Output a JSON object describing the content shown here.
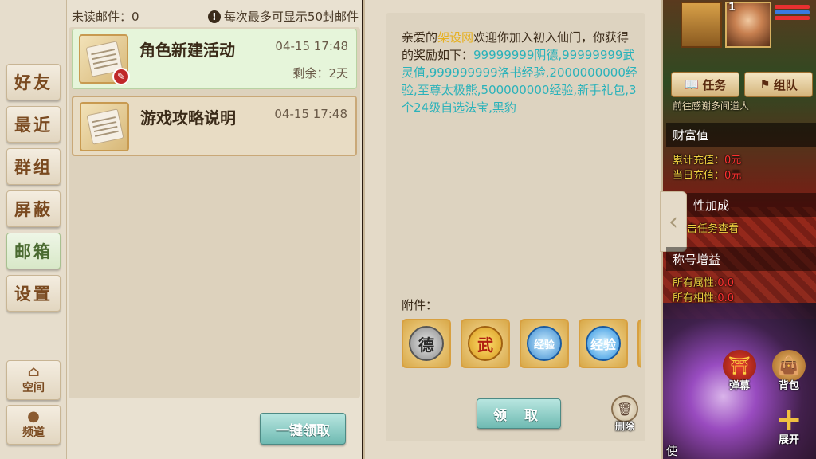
{
  "nav": {
    "items": [
      {
        "label": "好友"
      },
      {
        "label": "最近"
      },
      {
        "label": "群组"
      },
      {
        "label": "屏蔽"
      },
      {
        "label": "邮箱"
      },
      {
        "label": "设置"
      }
    ],
    "space_label": "空间",
    "channel_label": "频道"
  },
  "mailbox": {
    "unread_label": "未读邮件：0",
    "limit_notice": "每次最多可显示50封邮件",
    "mails": [
      {
        "title": "角色新建活动",
        "time": "04-15 17:48",
        "remain": "剩余：2天"
      },
      {
        "title": "游戏攻略说明",
        "time": "04-15 17:48"
      }
    ],
    "collect_all_label": "一键领取"
  },
  "detail": {
    "greeting_prefix": "亲爱的",
    "player_name": "架设网",
    "greeting_suffix": "欢迎你加入初入仙门，你获得的奖励如下：",
    "rewards": "99999999阴德,99999999武灵值,999999999洛书经验,2000000000经验,至尊太极熊,500000000经验,新手礼包,3个24级自选法宝,黑豹",
    "attachments_label": "附件：",
    "attachments": [
      {
        "glyph": "德"
      },
      {
        "glyph": "武"
      },
      {
        "glyph": "经验"
      },
      {
        "glyph": "经验"
      }
    ],
    "claim_label": "领 取",
    "delete_label": "删除"
  },
  "hud": {
    "level": "1",
    "task_label": "任务",
    "team_label": "组队",
    "escort_text": "前往感谢多闻道人",
    "wealth_title": "财富值",
    "total_recharge_label": "累计充值：",
    "total_recharge_value": "0元",
    "daily_recharge_label": "当日充值：",
    "daily_recharge_value": "0元",
    "attr_bonus_title": "性加成",
    "task_view_label": "击任务查看",
    "title_bonus_title": "称号增益",
    "all_attr_label": "所有属性:",
    "all_attr_value": "0.0",
    "all_phase_label": "所有相性:",
    "all_phase_value": "0.0",
    "popup_label": "弹幕",
    "bag_label": "背包",
    "expand_label": "展开",
    "bottom_char": "使"
  }
}
